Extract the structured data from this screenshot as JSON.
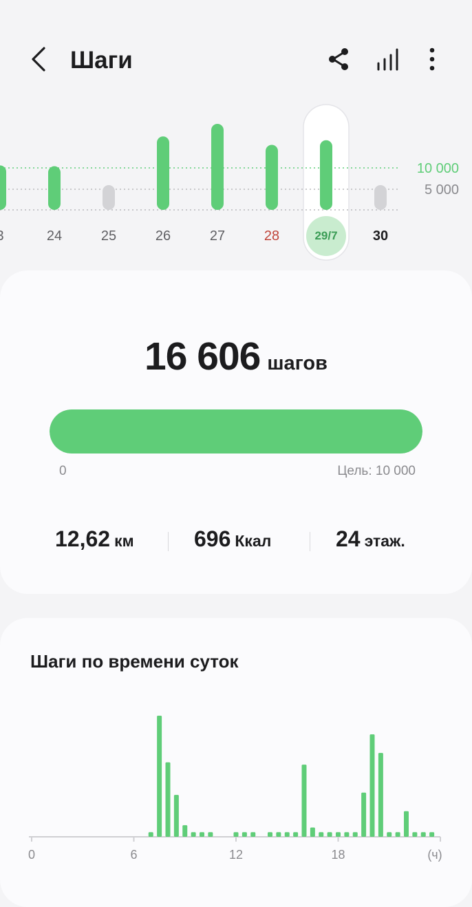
{
  "header": {
    "title": "Шаги",
    "icons": [
      "back-arrow-icon",
      "share-icon",
      "bar-chart-icon",
      "more-vertical-icon"
    ]
  },
  "week": {
    "goal_label": "10 000",
    "half_goal_label": "5 000",
    "days": [
      {
        "label": "3",
        "steps": 10600,
        "state": "met"
      },
      {
        "label": "24",
        "steps": 10400,
        "state": "met"
      },
      {
        "label": "25",
        "steps": 3500,
        "state": "low"
      },
      {
        "label": "26",
        "steps": 17500,
        "state": "met"
      },
      {
        "label": "27",
        "steps": 20500,
        "state": "met"
      },
      {
        "label": "28",
        "steps": 15500,
        "state": "met",
        "color": "#c0453a"
      },
      {
        "label": "29/7",
        "steps": 16606,
        "state": "met",
        "selected": true
      },
      {
        "label": "30",
        "steps": 3500,
        "state": "low",
        "bold": true
      }
    ]
  },
  "summary": {
    "steps": "16 606",
    "steps_unit": "шагов",
    "progress_fraction": 1.0,
    "progress_start": "0",
    "goal_text": "Цель: 10 000",
    "distance_value": "12,62",
    "distance_unit": "км",
    "calories_value": "696",
    "calories_unit": "Ккал",
    "floors_value": "24",
    "floors_unit": "этаж."
  },
  "chart_data": {
    "type": "bar",
    "title": "Шаги по времени суток",
    "xlabel": "(ч)",
    "x_ticks": [
      "0",
      "6",
      "12",
      "18"
    ],
    "xlim": [
      0,
      24
    ],
    "x": [
      7,
      7.5,
      8,
      8.5,
      9,
      9.5,
      10,
      10.5,
      12,
      12.5,
      13,
      14,
      14.5,
      15,
      15.5,
      16,
      16.5,
      17,
      17.5,
      18,
      18.5,
      19,
      19.5,
      20,
      20.5,
      21,
      21.5,
      22,
      22.5,
      23,
      23.5
    ],
    "values": [
      1,
      26,
      16,
      9,
      2.5,
      1,
      1,
      1,
      1,
      1,
      1,
      1,
      1,
      1,
      1,
      15.5,
      2,
      1,
      1,
      1,
      1,
      1,
      9.5,
      22,
      18,
      1,
      1,
      5.5,
      1,
      1,
      1
    ],
    "color": "#5fcd78"
  },
  "colors": {
    "accent_green": "#5fcd78",
    "goal_line": "#5fcd78",
    "low_bar": "#d3d3d6",
    "weekend_red": "#c0453a",
    "selected_bg": "#c9eccf"
  }
}
